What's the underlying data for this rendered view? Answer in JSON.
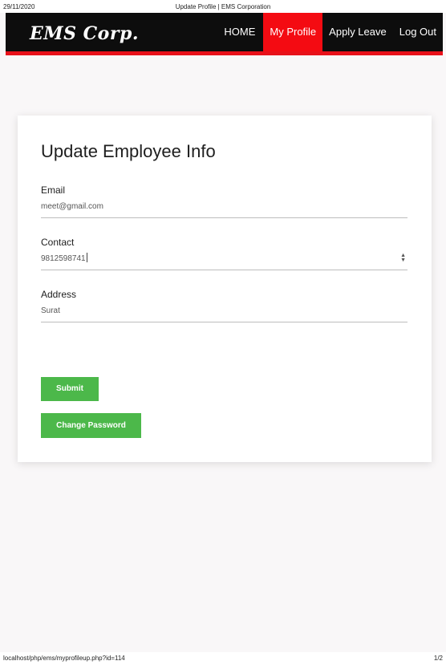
{
  "print": {
    "date": "29/11/2020",
    "page_title": "Update Profile | EMS Corporation",
    "url": "localhost/php/ems/myprofileup.php?id=114",
    "page_number": "1/2"
  },
  "navbar": {
    "brand": "EMS Corp.",
    "links": [
      {
        "label": "HOME",
        "active": false
      },
      {
        "label": "My Profile",
        "active": true
      },
      {
        "label": "Apply Leave",
        "active": false
      },
      {
        "label": "Log Out",
        "active": false
      }
    ]
  },
  "form": {
    "title": "Update Employee Info",
    "email": {
      "label": "Email",
      "value": "meet@gmail.com"
    },
    "contact": {
      "label": "Contact",
      "value": "9812598741"
    },
    "address": {
      "label": "Address",
      "value": "Surat"
    },
    "submit_label": "Submit",
    "change_password_label": "Change Password"
  },
  "colors": {
    "accent_red": "#f40b12",
    "nav_bg": "#0d0d0d",
    "button_green": "#4cb84a"
  }
}
